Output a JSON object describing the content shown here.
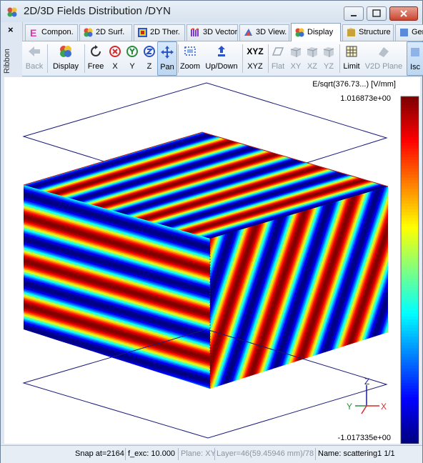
{
  "window": {
    "title": "2D/3D Fields Distribution /DYN",
    "controls": [
      "minimize",
      "maximize",
      "close"
    ]
  },
  "ribbon": {
    "close_glyph": "×",
    "label": "Ribbon"
  },
  "tabs": [
    {
      "label": "Compon.",
      "icon": "component-icon",
      "active": false
    },
    {
      "label": "2D Surf.",
      "icon": "surface-icon",
      "active": false
    },
    {
      "label": "2D Ther.",
      "icon": "thermal-icon",
      "active": false
    },
    {
      "label": "3D Vector",
      "icon": "vector-icon",
      "active": false
    },
    {
      "label": "3D View.",
      "icon": "view-icon",
      "active": false
    },
    {
      "label": "Display",
      "icon": "display-icon",
      "active": true
    },
    {
      "label": "Structure",
      "icon": "structure-icon",
      "active": false
    },
    {
      "label": "Gen",
      "icon": "general-icon",
      "active": false
    }
  ],
  "toolbar": {
    "back": "Back",
    "display": "Display",
    "free": "Free",
    "x": "X",
    "y": "Y",
    "z": "Z",
    "pan": "Pan",
    "zoom": "Zoom",
    "updown": "Up/Down",
    "xyz": "XYZ",
    "xyz_icon": "XYZ",
    "flat": "Flat",
    "xy": "XY",
    "xz": "XZ",
    "yz": "YZ",
    "limit": "Limit",
    "v2d": "V2D Plane",
    "iso": "Isc"
  },
  "colorbar": {
    "title": "E/sqrt(376.73...) [V/mm]",
    "max": "1.016873e+00",
    "min": "-1.017335e+00"
  },
  "axes": {
    "x": "X",
    "y": "Y",
    "z": "Z"
  },
  "status": {
    "snap": "Snap at=2164",
    "fexc": "f_exc: 10.000",
    "plane": "Plane: XY",
    "layer": "Layer=46(59.45946 mm)/78",
    "name": "Name: scattering1 1/1"
  }
}
